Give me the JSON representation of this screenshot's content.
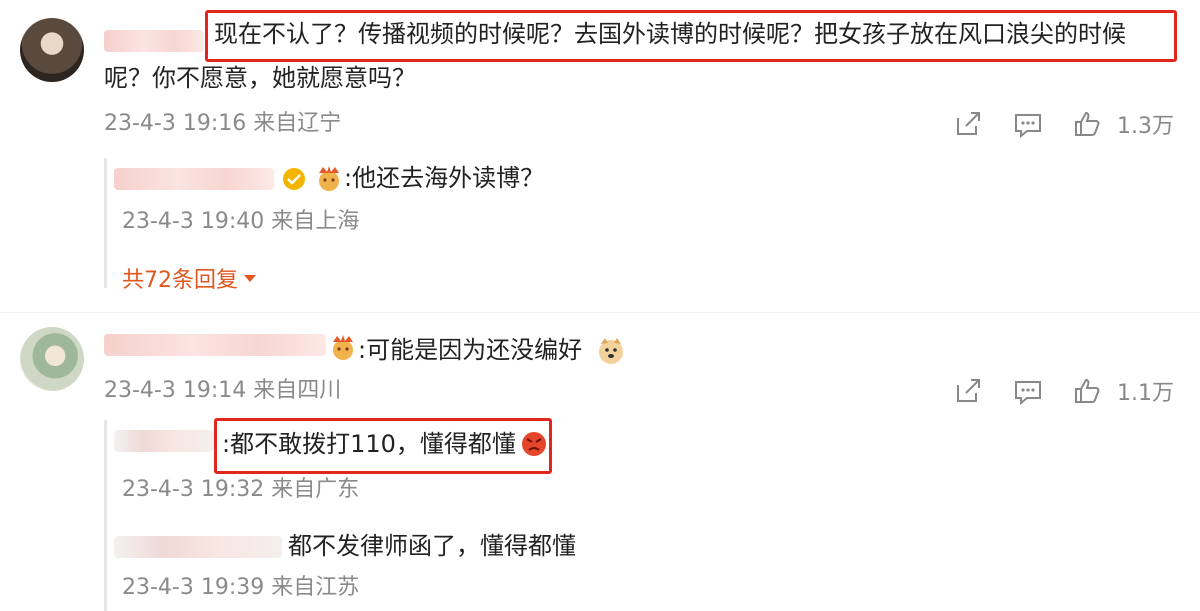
{
  "comments": [
    {
      "text": "现在不认了？传播视频的时候呢？去国外读博的时候呢？把女孩子放在风口浪尖的时候",
      "text_cont": "呢？你不愿意，她就愿意吗？",
      "meta": "23-4-3 19:16 来自辽宁",
      "likes": "1.3万",
      "replies": [
        {
          "text": ":他还去海外读博？",
          "meta": "23-4-3 19:40 来自上海"
        }
      ],
      "more_replies": "共72条回复"
    },
    {
      "text": ":可能是因为还没编好",
      "meta": "23-4-3 19:14 来自四川",
      "likes": "1.1万",
      "replies": [
        {
          "text": ":都不敢拨打110，懂得都懂",
          "meta": "23-4-3 19:32 来自广东"
        },
        {
          "text": "都不发律师函了，懂得都懂",
          "meta": "23-4-3 19:39 来自江苏"
        }
      ]
    }
  ],
  "icons": {
    "share": "share-icon",
    "comment": "comment-icon",
    "like": "thumbs-up-icon",
    "verified": "verified-badge-icon",
    "fan_badge": "fan-crown-icon",
    "emoji_doge": "doge-emoji-icon",
    "emoji_angry": "angry-emoji-icon",
    "dropdown": "caret-down-icon"
  },
  "colors": {
    "highlight": "#e0261e",
    "meta_text": "#8a8a8a",
    "more_replies": "#e0571f"
  }
}
